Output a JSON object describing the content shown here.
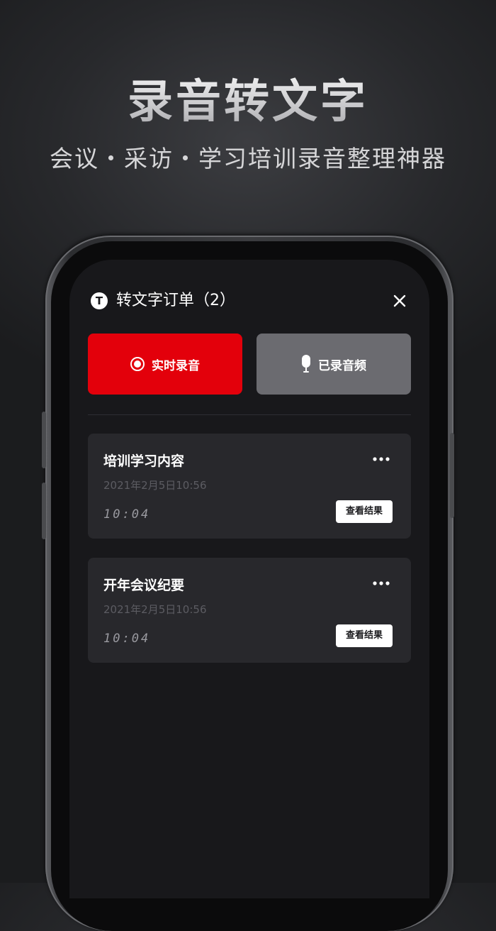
{
  "hero": {
    "title": "录音转文字",
    "subtitle": "会议・采访・学习培训录音整理神器"
  },
  "header": {
    "brand_icon": "T",
    "title": "转文字订单（2）",
    "close_icon": "close-icon"
  },
  "modes": {
    "live_label": "实时录音",
    "file_label": "已录音频"
  },
  "orders": [
    {
      "title": "培训学习内容",
      "time": "2021年2月5日10:56",
      "duration": "10:04",
      "action": "查看结果"
    },
    {
      "title": "开年会议纪要",
      "time": "2021年2月5日10:56",
      "duration": "10:04",
      "action": "查看结果"
    }
  ],
  "colors": {
    "accent": "#e3000b",
    "secondary_button": "#6b6b70",
    "card": "#28282c",
    "screen": "#18181b"
  }
}
